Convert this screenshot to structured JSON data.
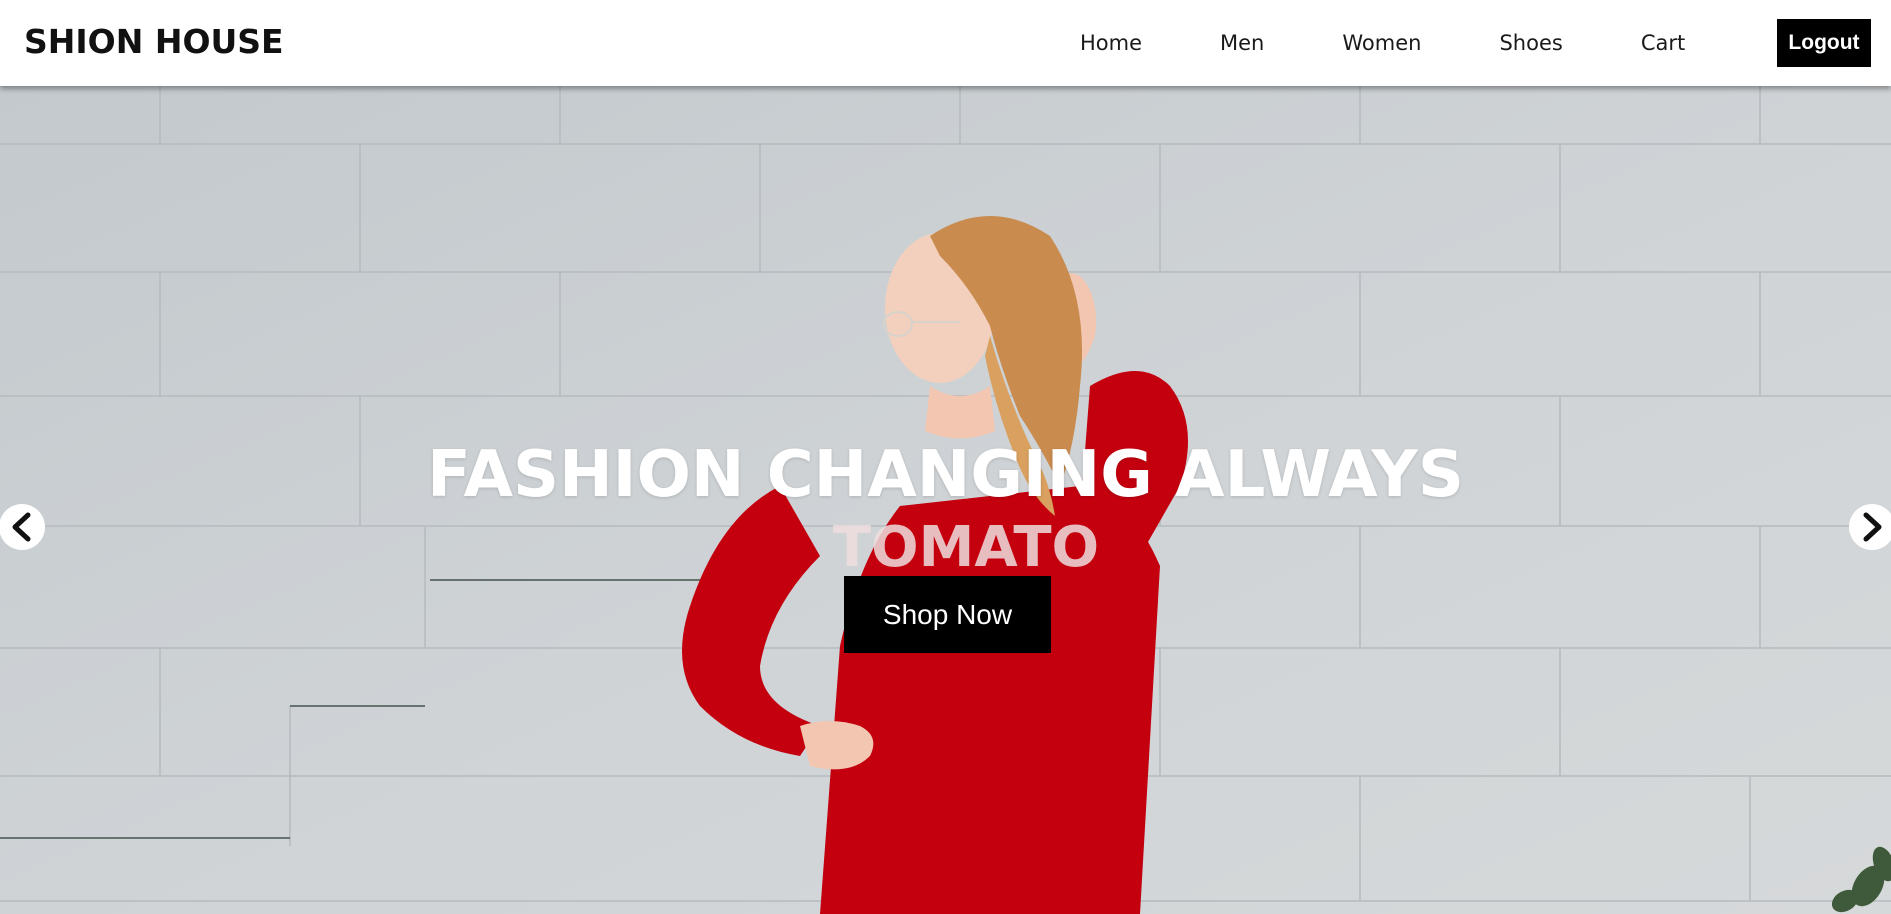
{
  "header": {
    "brand": "SHION HOUSE",
    "nav": [
      {
        "label": "Home"
      },
      {
        "label": "Men"
      },
      {
        "label": "Women"
      },
      {
        "label": "Shoes"
      },
      {
        "label": "Cart"
      }
    ],
    "logout_label": "Logout"
  },
  "hero": {
    "headline": "FASHION CHANGING ALWAYS",
    "cta_label": "Shop Now",
    "prev_icon": "chevron-left-icon",
    "next_icon": "chevron-right-icon",
    "sweater_text": "TOMATO"
  },
  "colors": {
    "header_bg": "#ffffff",
    "button_bg": "#000000",
    "button_text": "#ffffff",
    "wall": "#c8cdd0",
    "sweater": "#c4000f",
    "hair": "#c98b4e"
  }
}
